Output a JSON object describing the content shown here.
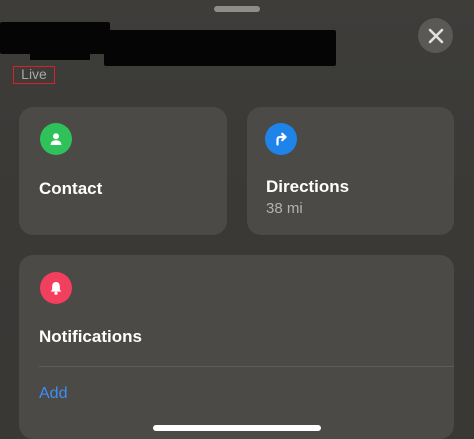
{
  "header": {
    "status_label": "Live"
  },
  "cards": {
    "contact": {
      "title": "Contact",
      "icon": "person-icon",
      "icon_color": "#30c25a"
    },
    "directions": {
      "title": "Directions",
      "subtitle": "38 mi",
      "icon": "turn-right-arrow-icon",
      "icon_color": "#1e84ea"
    },
    "notifications": {
      "title": "Notifications",
      "icon": "bell-icon",
      "icon_color": "#f23f5e",
      "action_label": "Add"
    }
  },
  "colors": {
    "accent": "#3d8ff5",
    "highlight_box": "#d9202a"
  }
}
